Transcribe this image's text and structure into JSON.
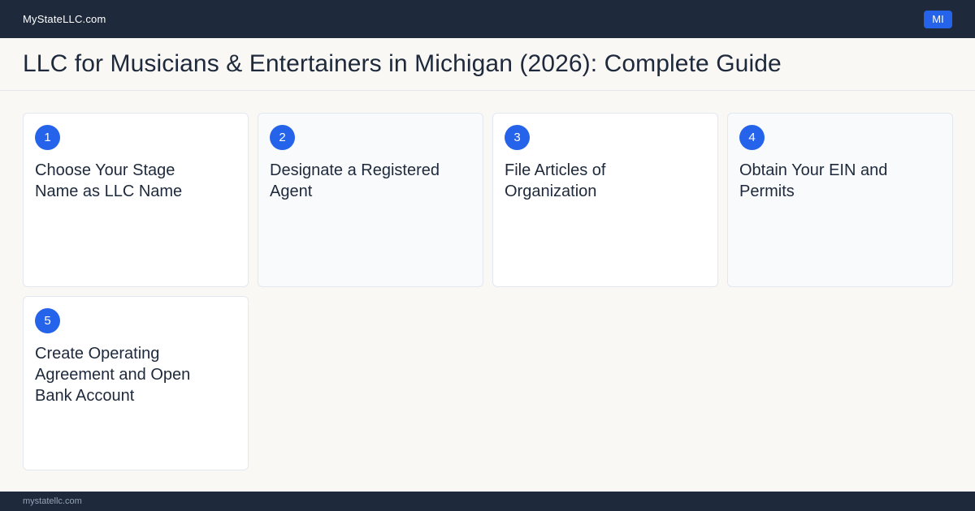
{
  "header": {
    "site_name": "MyStateLLC.com",
    "state_badge": "MI"
  },
  "page": {
    "title": "LLC for Musicians & Entertainers in Michigan (2026): Complete Guide"
  },
  "steps": [
    {
      "number": "1",
      "title": "Choose Your Stage Name as LLC Name"
    },
    {
      "number": "2",
      "title": "Designate a Registered Agent"
    },
    {
      "number": "3",
      "title": "File Articles of Organization"
    },
    {
      "number": "4",
      "title": "Obtain Your EIN and Permits"
    },
    {
      "number": "5",
      "title": "Create Operating Agreement and Open Bank Account"
    }
  ],
  "footer": {
    "url": "mystatellc.com"
  },
  "colors": {
    "dark_bar": "#1e293b",
    "accent": "#2563eb",
    "page_bg": "#f9f8f5"
  }
}
